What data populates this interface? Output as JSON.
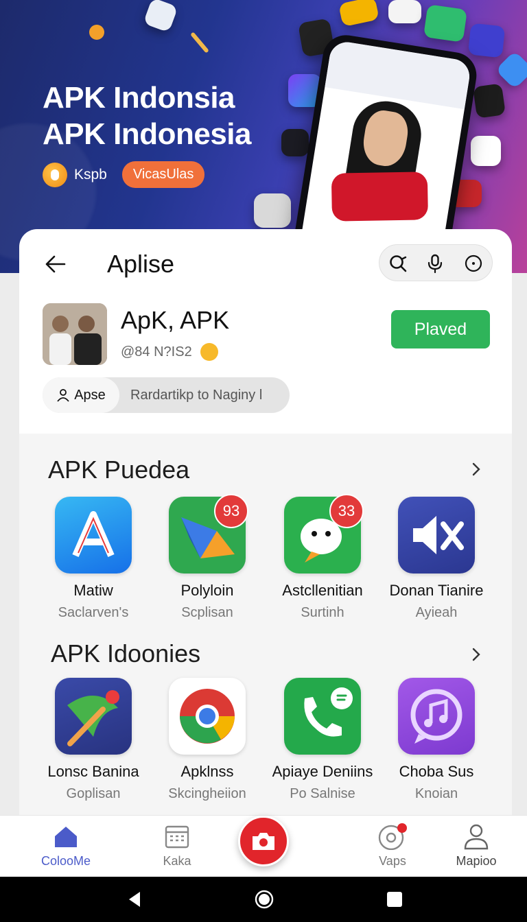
{
  "hero": {
    "title_line1": "APK Indonsia",
    "title_line2": "APK Indonesia",
    "handle": "Kspb",
    "button_label": "VicasUlas"
  },
  "header": {
    "title": "Aplise"
  },
  "profile": {
    "name": "ApK, APK",
    "handle": "@84 N?IS2",
    "action_label": "Plaved"
  },
  "segments": {
    "active_label": "Apse",
    "other_label": "Rardartikp to Naginy l"
  },
  "sections": [
    {
      "title": "APK Puedea",
      "apps": [
        {
          "name": "Matiw",
          "subtitle": "Saclarven's",
          "badge": ""
        },
        {
          "name": "Polyloin",
          "subtitle": "Scplisan",
          "badge": "93"
        },
        {
          "name": "Astcllenitian",
          "subtitle": "Surtinh",
          "badge": "33"
        },
        {
          "name": "Donan Tianire",
          "subtitle": "Ayieah",
          "badge": ""
        }
      ]
    },
    {
      "title": "APK Idoonies",
      "apps": [
        {
          "name": "Lonsc Banina",
          "subtitle": "Goplisan",
          "badge": ""
        },
        {
          "name": "Apklnss",
          "subtitle": "Skcingheiion",
          "badge": ""
        },
        {
          "name": "Apiaye Deniins",
          "subtitle": "Po Salnise",
          "badge": ""
        },
        {
          "name": "Choba Sus",
          "subtitle": "Knoian",
          "badge": ""
        }
      ]
    }
  ],
  "bottom_nav": [
    {
      "label": "ColooMe",
      "icon": "home-icon",
      "active": true
    },
    {
      "label": "Kaka",
      "icon": "calendar-icon",
      "active": false
    },
    {
      "label": "",
      "icon": "camera-icon",
      "active": false
    },
    {
      "label": "Vaps",
      "icon": "disc-icon",
      "active": false
    },
    {
      "label": "Mapioo",
      "icon": "profile-icon",
      "active": false
    }
  ],
  "colors": {
    "accent_green": "#2fb45a",
    "accent_red": "#e1252b",
    "nav_active": "#4b5bc9",
    "hero_button": "#f0703a"
  }
}
